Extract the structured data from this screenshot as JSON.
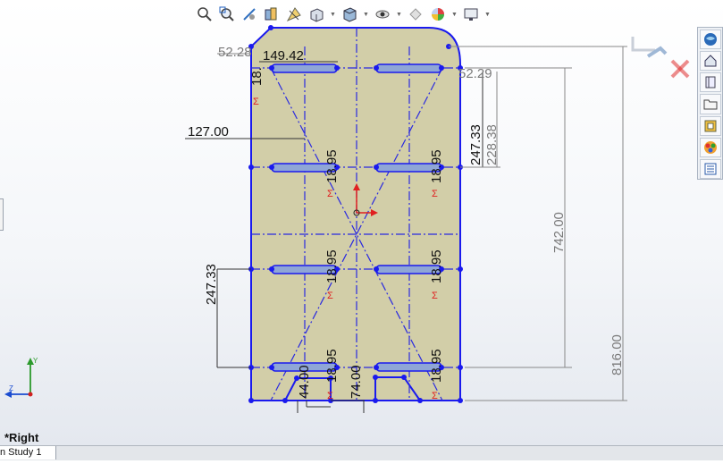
{
  "toolbar": {
    "icons": [
      "zoom-to-fit-icon",
      "zoom-to-area-icon",
      "previous-view-icon",
      "section-view-icon",
      "dynamic-annotation-icon",
      "view-orientation-icon",
      "display-style-icon",
      "hide-show-icon",
      "edit-appearance-icon",
      "apply-scene-icon",
      "view-settings-icon"
    ]
  },
  "taskpane": {
    "icons": [
      "resources-icon",
      "design-library-icon",
      "file-explorer-icon",
      "open-folder-icon",
      "view-palette-icon",
      "appearances-icon",
      "custom-properties-icon"
    ]
  },
  "confirm_corner": {
    "icons": [
      "accept-icon",
      "cancel-icon"
    ],
    "cancel_color": "#e03030"
  },
  "dimensions": {
    "top_left_offset": "52.28",
    "top_slot_width": "149.42",
    "top_slot_height": "18.",
    "left_offset": "127.00",
    "slot_height_1": "18.95",
    "slot_height_2": "18.95",
    "slot_height_3": "18.95",
    "slot_height_4": "18.95",
    "slot_height_5": "18.95",
    "slot_height_6": "18.95",
    "slot_height_7": "18.95",
    "right_top_small": "52.29",
    "right_spacing_1": "247.33",
    "right_spacing_2": "228.38",
    "left_spacing": "247.33",
    "overall_742": "742.00",
    "overall_816": "816.00",
    "bottom_44": "44.00",
    "bottom_74": "74.00"
  },
  "colors": {
    "sketch_line": "#0000ee",
    "fill": "#d2cea8",
    "dimension": "#7a7a7a",
    "relation_red": "#e02020"
  },
  "view": {
    "name": "*Right"
  },
  "tabs": [
    {
      "label": "n Study 1"
    }
  ]
}
